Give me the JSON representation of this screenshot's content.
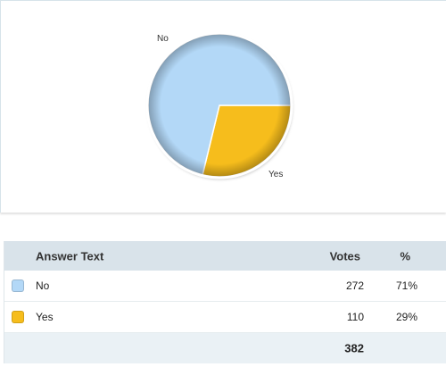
{
  "chart_data": {
    "type": "pie",
    "slices": [
      {
        "label": "No",
        "value": 272,
        "color": "#b3d8f7"
      },
      {
        "label": "Yes",
        "value": 110,
        "color": "#f6bd1c"
      }
    ]
  },
  "table": {
    "headers": {
      "answer": "Answer Text",
      "votes": "Votes",
      "percent": "%"
    },
    "rows": [
      {
        "answer": "No",
        "votes": "272",
        "percent": "71%",
        "color": "#b3d8f7"
      },
      {
        "answer": "Yes",
        "votes": "110",
        "percent": "29%",
        "color": "#f6bd1c"
      }
    ],
    "total": "382"
  }
}
